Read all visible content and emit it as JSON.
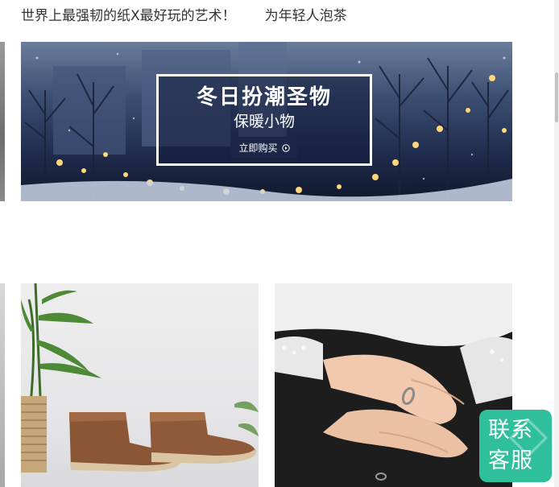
{
  "top_links": [
    {
      "label": "世界上最强韧的纸X最好玩的艺术！"
    },
    {
      "label": "为年轻人泡茶"
    }
  ],
  "banner": {
    "title": "冬日扮潮圣物",
    "subtitle": "保暖小物",
    "button_label": "立即购买"
  },
  "products": [
    {
      "name": "boots",
      "image": "brown-canvas-boots"
    },
    {
      "name": "ring",
      "image": "hands-with-ring"
    }
  ],
  "service": {
    "line1": "联系",
    "line2": "客服",
    "color": "#2fbf9b"
  }
}
